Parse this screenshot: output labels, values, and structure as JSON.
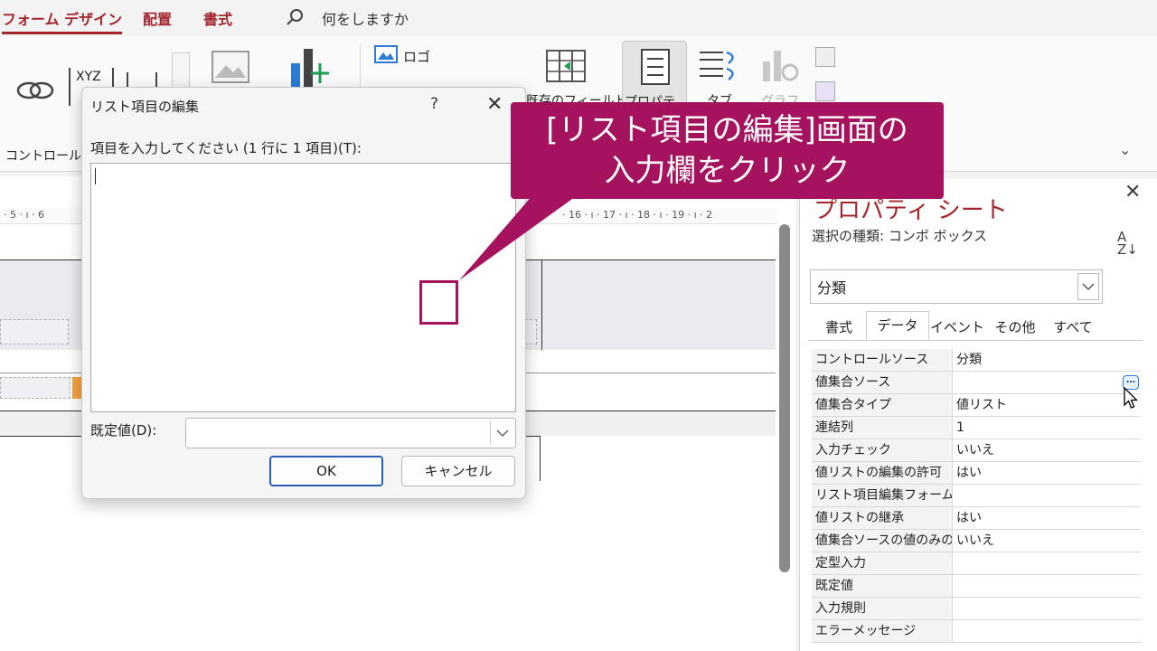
{
  "ribbon_tabs": [
    {
      "label": "フォーム デザイン",
      "active": true
    },
    {
      "label": "配置",
      "active": false
    },
    {
      "label": "書式",
      "active": false
    }
  ],
  "search": {
    "text": "何をしますか"
  },
  "ribbon": {
    "xyz_label": "XYZ",
    "logo_label": "ロゴ",
    "existing_fields_label": "既存のフィールド",
    "property_label": "プロパティ",
    "tab_label": "タブ",
    "graph_label": "グラフ",
    "control_group_label": "コントロール"
  },
  "ruler": {
    "left_ticks": "· 5 · ı · 6",
    "right_ticks": "· 16 · ı · 17 · ı · 18 · ı · 19 · ı · 2"
  },
  "property_sheet": {
    "title": "プロパティ シート",
    "close_glyph": "✕",
    "selection_type": "選択の種類:  コンボ ボックス",
    "sort_icon": "A\nZ↓",
    "selected_control": "分類",
    "tabs": [
      "書式",
      "データ",
      "イベント",
      "その他",
      "すべて"
    ],
    "active_tab": "データ",
    "rows": [
      {
        "label": "コントロールソース",
        "value": "分類"
      },
      {
        "label": "値集合ソース",
        "value": ""
      },
      {
        "label": "値集合タイプ",
        "value": "値リスト"
      },
      {
        "label": "連結列",
        "value": "1"
      },
      {
        "label": "入力チェック",
        "value": "いいえ"
      },
      {
        "label": "値リストの編集の許可",
        "value": "はい"
      },
      {
        "label": "リスト項目編集フォーム",
        "value": ""
      },
      {
        "label": "値リストの継承",
        "value": "はい"
      },
      {
        "label": "値集合ソースの値のみの表示",
        "value": "いいえ"
      },
      {
        "label": "定型入力",
        "value": ""
      },
      {
        "label": "既定値",
        "value": ""
      },
      {
        "label": "入力規則",
        "value": ""
      },
      {
        "label": "エラーメッセージ",
        "value": ""
      }
    ],
    "builder_glyph": "…"
  },
  "dialog": {
    "title": "リスト項目の編集",
    "help_glyph": "?",
    "close_glyph": "✕",
    "prompt": "項目を入力してください (1 行に 1 項目)(T):",
    "textarea_value": "",
    "default_label": "既定値(D):",
    "default_value": "",
    "ok_label": "OK",
    "cancel_label": "キャンセル"
  },
  "callout": {
    "line1": "[リスト項目の編集]画面の",
    "line2": "入力欄をクリック"
  },
  "colors": {
    "accent": "#a4262c",
    "callout": "#a5125d",
    "focus_blue": "#2b5fb4"
  }
}
